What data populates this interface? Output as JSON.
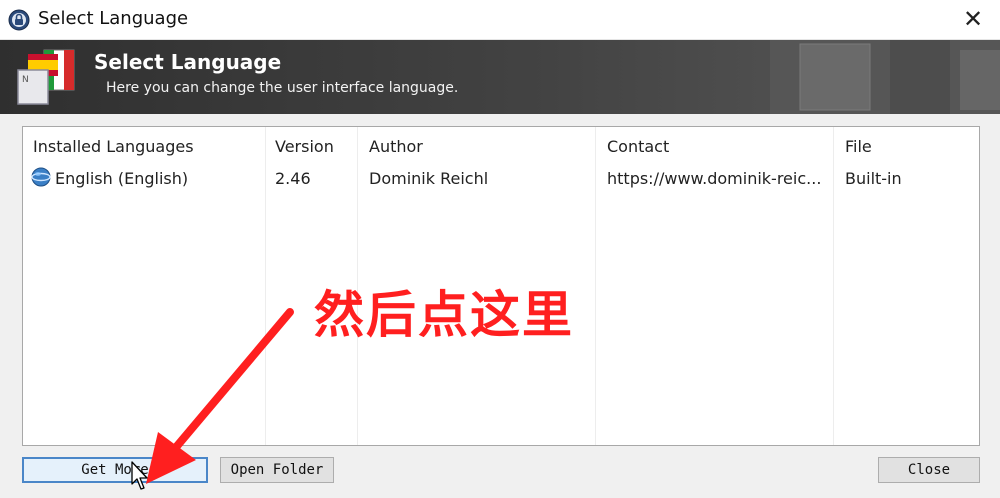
{
  "window": {
    "title": "Select Language",
    "close_glyph": "✕",
    "app_icon": "keepass-lock-icon"
  },
  "banner": {
    "title": "Select Language",
    "subtitle": "Here you can change the user interface language.",
    "icon": "language-flags-icon"
  },
  "list": {
    "columns": [
      "Installed Languages",
      "Version",
      "Author",
      "Contact",
      "File"
    ],
    "rows": [
      {
        "language": "English (English)",
        "version": "2.46",
        "author": "Dominik Reichl",
        "contact": "https://www.dominik-reic...",
        "file": "Built-in",
        "icon": "globe-icon"
      }
    ]
  },
  "buttons": {
    "get_more": "Get More",
    "open_folder": "Open Folder",
    "close": "Close"
  },
  "annotation": {
    "text": "然后点这里",
    "color": "#ff1f1f"
  },
  "colors": {
    "banner": "#3c3c3c",
    "default_button_border": "#4a86c8"
  }
}
